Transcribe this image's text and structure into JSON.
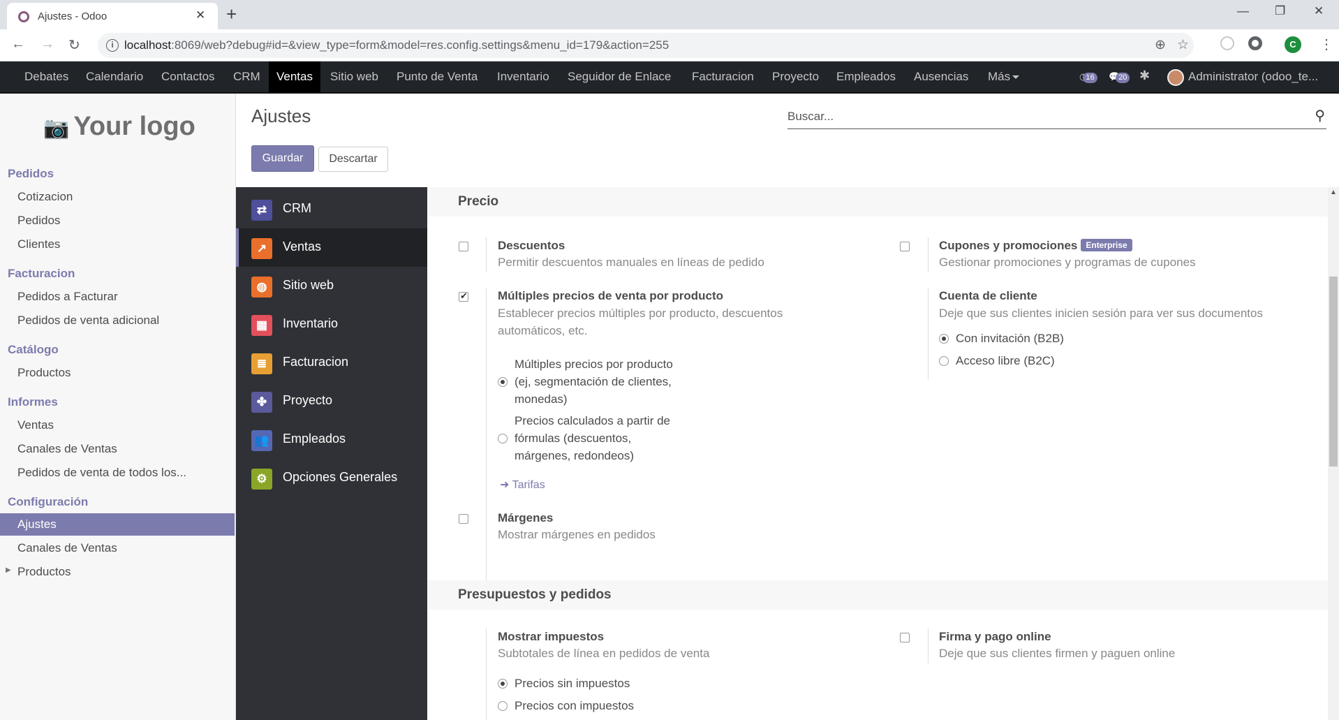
{
  "browser": {
    "tab_title": "Ajustes - Odoo",
    "url_host": "localhost",
    "url_rest": ":8069/web?debug#id=&view_type=form&model=res.config.settings&menu_id=179&action=255",
    "profile_letter": "C"
  },
  "topnav": {
    "items": [
      "Debates",
      "Calendario",
      "Contactos",
      "CRM",
      "Ventas",
      "Sitio web",
      "Punto de Venta",
      "Inventario",
      "Seguidor de Enlace",
      "Facturacion",
      "Proyecto",
      "Empleados",
      "Ausencias",
      "Más"
    ],
    "active": "Ventas",
    "activity_count": "16",
    "message_count": "20",
    "user": "Administrator (odoo_te..."
  },
  "sidebar": {
    "logo": "Your logo",
    "sections": [
      {
        "title": "Pedidos",
        "items": [
          "Cotizacion",
          "Pedidos",
          "Clientes"
        ]
      },
      {
        "title": "Facturacion",
        "items": [
          "Pedidos a Facturar",
          "Pedidos de venta adicional"
        ]
      },
      {
        "title": "Catálogo",
        "items": [
          "Productos"
        ]
      },
      {
        "title": "Informes",
        "items": [
          "Ventas",
          "Canales de Ventas",
          "Pedidos de venta de todos los..."
        ]
      },
      {
        "title": "Configuración",
        "items": [
          "Ajustes",
          "Canales de Ventas",
          "Productos"
        ]
      }
    ],
    "active_item": "Ajustes"
  },
  "control_panel": {
    "title": "Ajustes",
    "search_placeholder": "Buscar...",
    "save_label": "Guardar",
    "discard_label": "Descartar"
  },
  "settings_apps": {
    "items": [
      {
        "label": "CRM",
        "icon": "handshake-icon",
        "color": "#4f4f9c"
      },
      {
        "label": "Ventas",
        "icon": "chart-line-icon",
        "color": "#e96f2b"
      },
      {
        "label": "Sitio web",
        "icon": "globe-icon",
        "color": "#e96f2b"
      },
      {
        "label": "Inventario",
        "icon": "box-icon",
        "color": "#e3505b"
      },
      {
        "label": "Facturacion",
        "icon": "invoice-icon",
        "color": "#e79f33"
      },
      {
        "label": "Proyecto",
        "icon": "puzzle-icon",
        "color": "#5a5a9c"
      },
      {
        "label": "Empleados",
        "icon": "people-icon",
        "color": "#5468b5"
      },
      {
        "label": "Opciones Generales",
        "icon": "gear-icon",
        "color": "#8aa628"
      }
    ],
    "active": "Ventas"
  },
  "content": {
    "precio": {
      "title": "Precio",
      "descuentos": {
        "title": "Descuentos",
        "desc": "Permitir descuentos manuales en líneas de pedido",
        "checked": false
      },
      "cupones": {
        "title": "Cupones y promociones",
        "badge": "Enterprise",
        "desc": "Gestionar promociones y programas de cupones",
        "checked": false
      },
      "multiples": {
        "title": "Múltiples precios de venta por producto",
        "desc_line1": "Establecer precios múltiples por producto, descuentos",
        "desc_line2": "automáticos, etc.",
        "checked": true,
        "option1_l1": "Múltiples precios por producto",
        "option1_l2": "(ej, segmentación de clientes,",
        "option1_l3": "monedas)",
        "option2_l1": "Precios calculados a partir de",
        "option2_l2": "fórmulas (descuentos,",
        "option2_l3": "márgenes, redondeos)",
        "selected_option": 1,
        "link": "Tarifas"
      },
      "cuenta": {
        "title": "Cuenta de cliente",
        "desc": "Deje que sus clientes inicien sesión para ver sus documentos",
        "option1": "Con invitación (B2B)",
        "option2": "Acceso libre (B2C)",
        "selected_option": 1
      },
      "margenes": {
        "title": "Márgenes",
        "desc": "Mostrar márgenes en pedidos",
        "checked": false
      }
    },
    "presupuestos": {
      "title": "Presupuestos y pedidos",
      "impuestos": {
        "title": "Mostrar impuestos",
        "desc": "Subtotales de línea en pedidos de venta",
        "option1": "Precios sin impuestos",
        "option2": "Precios con impuestos",
        "selected_option": 1
      },
      "firma": {
        "title": "Firma y pago online",
        "desc": "Deje que sus clientes firmen y paguen online",
        "checked": false
      }
    }
  }
}
